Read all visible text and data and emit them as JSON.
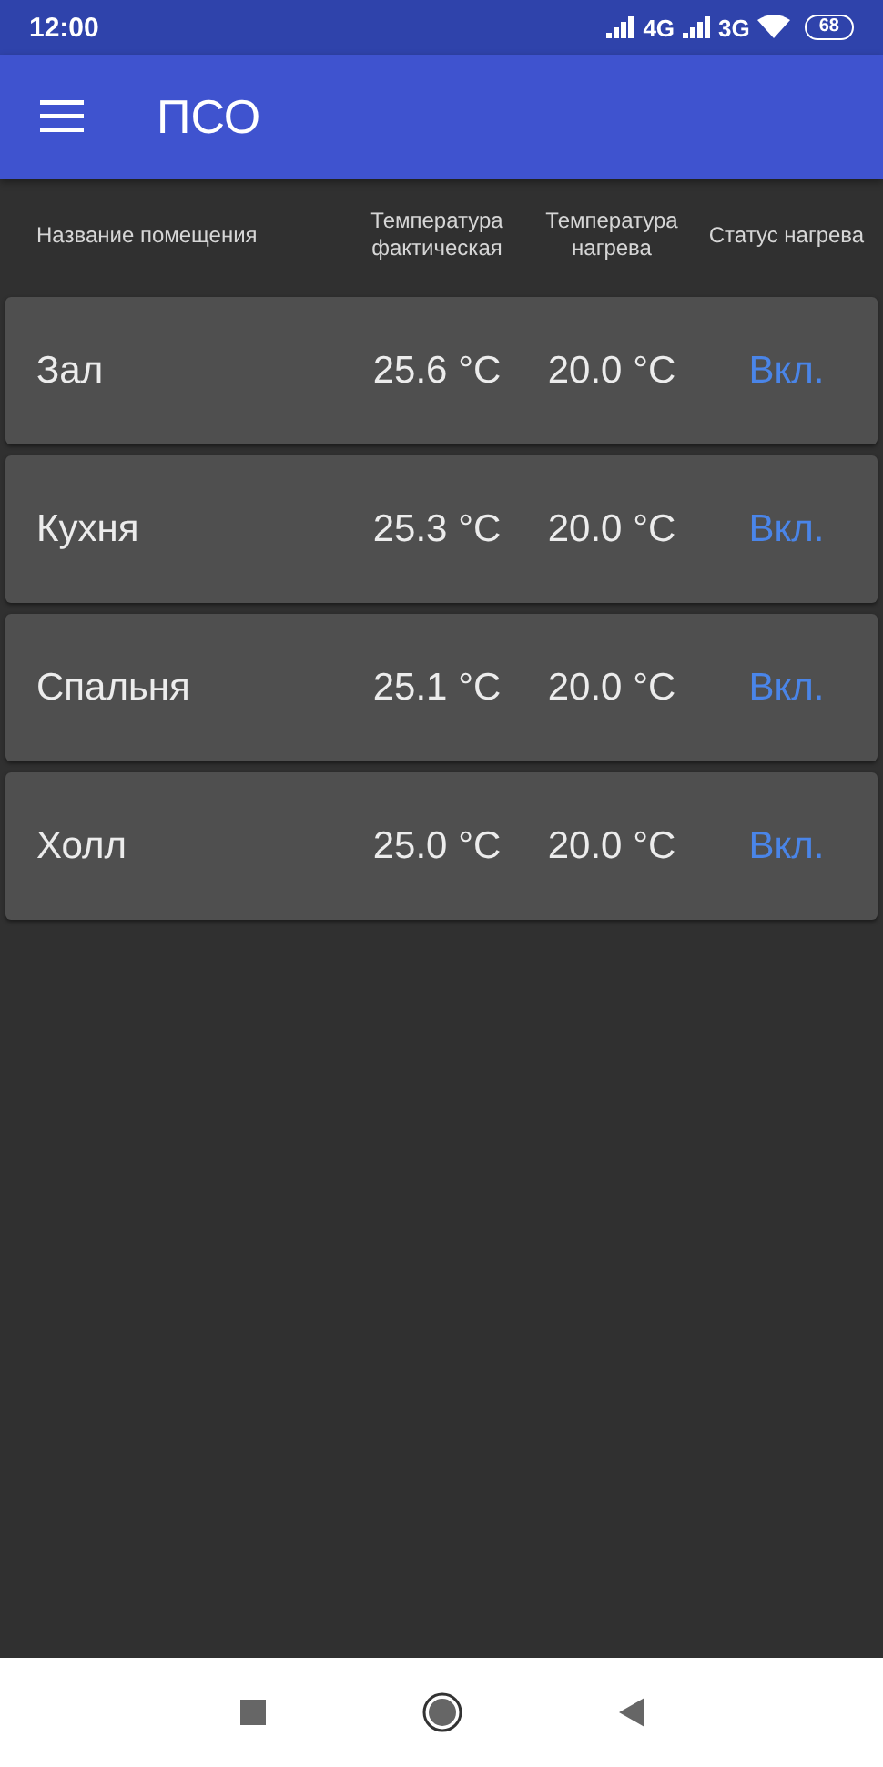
{
  "status_bar": {
    "time": "12:00",
    "network_1": "4G",
    "network_2": "3G",
    "battery": "68"
  },
  "app_bar": {
    "title": "ПСО"
  },
  "table": {
    "columns": [
      "Название помещения",
      "Температура фактическая",
      "Температура нагрева",
      "Статус нагрева"
    ],
    "rows": [
      {
        "room": "Зал",
        "actual": "25.6 °C",
        "target": "20.0 °C",
        "status": "Вкл."
      },
      {
        "room": "Кухня",
        "actual": "25.3 °C",
        "target": "20.0 °C",
        "status": "Вкл."
      },
      {
        "room": "Спальня",
        "actual": "25.1 °C",
        "target": "20.0 °C",
        "status": "Вкл."
      },
      {
        "room": "Холл",
        "actual": "25.0 °C",
        "target": "20.0 °C",
        "status": "Вкл."
      }
    ]
  }
}
